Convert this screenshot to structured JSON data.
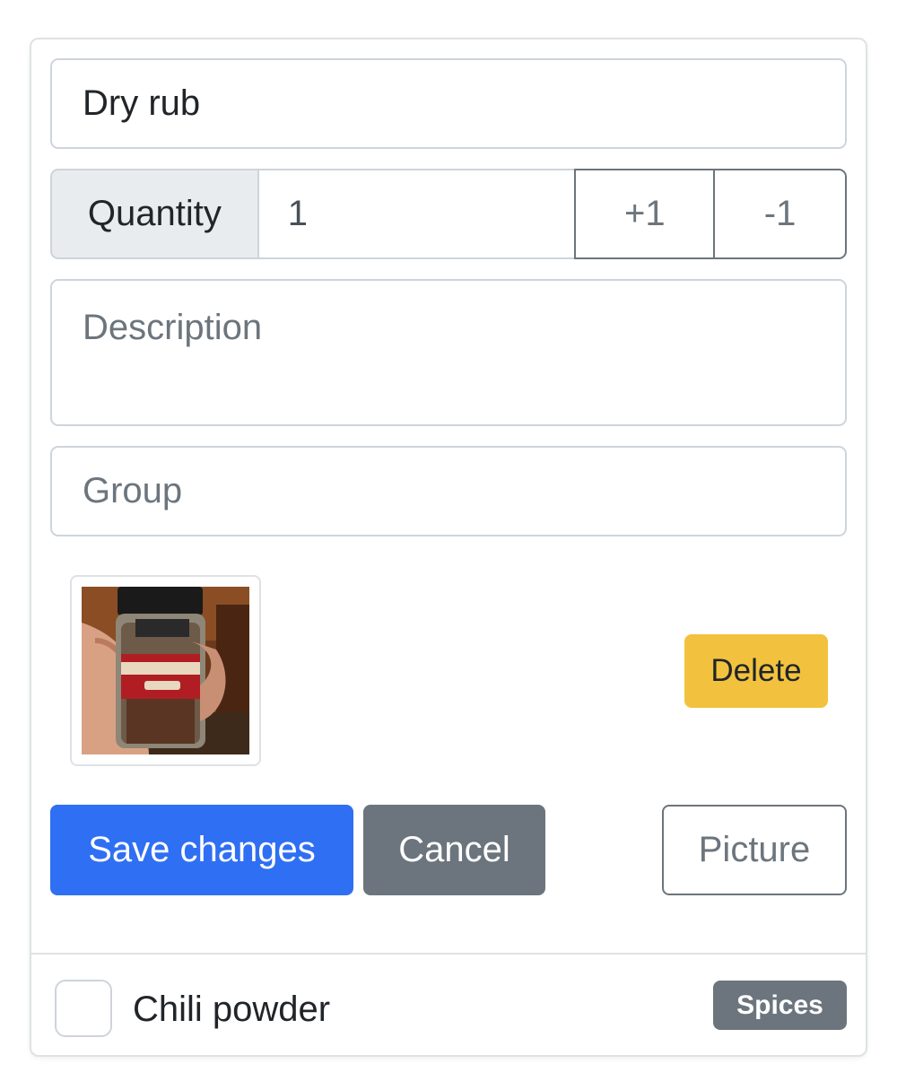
{
  "form": {
    "name_value": "Dry rub",
    "quantity_label": "Quantity",
    "quantity_value": "1",
    "increment_label": "+1",
    "decrement_label": "-1",
    "description_placeholder": "Description",
    "group_placeholder": "Group",
    "image": {
      "semantic": "photo of hand holding Applewood rub spice jar"
    }
  },
  "actions": {
    "delete_label": "Delete",
    "save_label": "Save changes",
    "cancel_label": "Cancel",
    "picture_label": "Picture"
  },
  "list": {
    "items": [
      {
        "label": "Chili powder",
        "badge": "Spices",
        "checked": false
      }
    ]
  },
  "colors": {
    "primary": "#2f6ff3",
    "secondary": "#6c757d",
    "warning": "#f2c23e"
  }
}
